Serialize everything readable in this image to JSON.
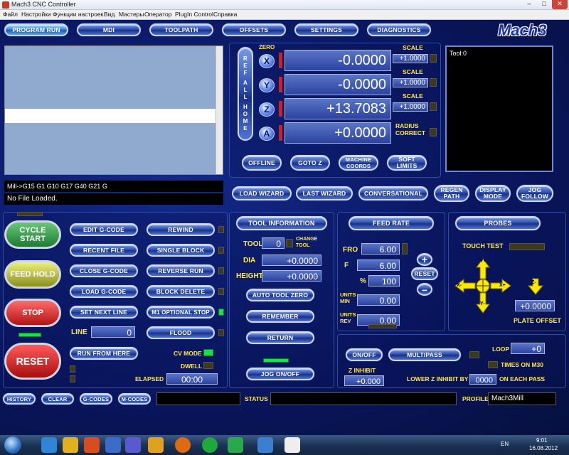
{
  "window": {
    "title": "Mach3 CNC Controller",
    "minimize": "–",
    "maximize": "□",
    "close": "✕"
  },
  "menu": [
    "Файл",
    "Настройки",
    "Функции настроек",
    "Вид",
    "Мастеры",
    "Оператор",
    "PlugIn Control",
    "Справка"
  ],
  "tabs": [
    "PROGRAM RUN",
    "MDI",
    "TOOLPATH",
    "OFFSETS",
    "SETTINGS",
    "DIAGNOSTICS"
  ],
  "logo": "Mach3",
  "gcode_line": "Mill->G15  G1 G10 G17 G40 G21 G",
  "file_status": "No File Loaded.",
  "dro": {
    "zero_label": "ZERO",
    "ref_all_home": [
      "R",
      "E",
      "F",
      "A",
      "L",
      "L",
      "H",
      "O",
      "M",
      "E"
    ],
    "axes": [
      {
        "name": "X",
        "value": "-0.0000",
        "scale_label": "SCALE",
        "scale": "+1.0000"
      },
      {
        "name": "Y",
        "value": "-0.0000",
        "scale_label": "SCALE",
        "scale": "+1.0000"
      },
      {
        "name": "Z",
        "value": "+13.7083",
        "scale_label": "SCALE",
        "scale": "+1.0000"
      },
      {
        "name": "A",
        "value": "+0.0000",
        "scale_label": "RADIUS CORRECT",
        "scale": ""
      }
    ],
    "buttons": [
      "OFFLINE",
      "GOTO Z",
      "MACHINE COORDS",
      "SOFT LIMITS"
    ]
  },
  "toolpath": {
    "label": "Tool:0"
  },
  "wizard_bar": [
    "LOAD WIZARD",
    "LAST WIZARD",
    "CONVERSATIONAL",
    "REGEN PATH",
    "DISPLAY MODE",
    "JOG FOLLOW"
  ],
  "cycle": {
    "start": "CYCLE START",
    "hold": "FEED HOLD",
    "stop": "STOP",
    "reset": "RESET"
  },
  "file_buttons_left": [
    "EDIT G-CODE",
    "RECENT FILE",
    "CLOSE G-CODE",
    "LOAD G-CODE",
    "SET NEXT LINE"
  ],
  "file_buttons_right": [
    "REWIND",
    "SINGLE BLOCK",
    "REVERSE RUN",
    "BLOCK DELETE",
    "M1 OPTIONAL STOP",
    "FLOOD"
  ],
  "line": {
    "label": "LINE",
    "value": "0"
  },
  "run_from_here": "RUN FROM HERE",
  "cv_mode": "CV MODE",
  "dwell": "DWELL",
  "elapsed": {
    "label": "ELAPSED",
    "value": "00:00"
  },
  "tool_info": {
    "title": "TOOL INFORMATION",
    "tool_label": "TOOL",
    "tool_value": "0",
    "change_tool": "CHANGE TOOL",
    "dia_label": "DIA",
    "dia_value": "+0.0000",
    "height_label": "HEIGHT",
    "height_value": "+0.0000",
    "buttons": [
      "AUTO TOOL ZERO",
      "REMEMBER",
      "RETURN"
    ],
    "jog": "JOG  ON/OFF"
  },
  "feed": {
    "title": "FEED RATE",
    "fro_label": "FRO",
    "fro_value": "6.00",
    "f_label": "F",
    "f_value": "6.00",
    "pct_label": "%",
    "pct_value": "100",
    "units_min_label": "UNITS MIN",
    "units_min_value": "0.00",
    "units_rev_label": "UNITS REV",
    "units_rev_value": "0.00",
    "plus": "+",
    "reset": "RESET",
    "minus": "–"
  },
  "probes": {
    "title": "PROBES",
    "touch": "TOUCH TEST",
    "y_plus": "Y+",
    "y_minus": "Y-",
    "x_minus": "X-",
    "x_plus": "X+",
    "z_minus": "Z-",
    "plate_value": "+0.0000",
    "plate_label": "PLATE OFFSET"
  },
  "multipass": {
    "onoff": "ON/OFF",
    "multipass": "MULTIPASS",
    "loop_label": "LOOP",
    "loop_value": "+0",
    "times": "TIMES ON M30",
    "z_inhibit": "Z INHIBIT",
    "z_value": "+0.000",
    "lower_label": "LOWER Z INHIBIT BY",
    "lower_value": "0000",
    "each_pass": "ON EACH PASS"
  },
  "bottom": {
    "history": "HISTORY",
    "clear": "CLEAR",
    "gcodes": "G-CODES",
    "mcodes": "M-CODES",
    "status": "STATUS",
    "profile_label": "PROFILE",
    "profile_value": "Mach3Mill"
  },
  "taskbar": {
    "lang": "EN",
    "time": "9:01",
    "date": "16.08.2012"
  }
}
